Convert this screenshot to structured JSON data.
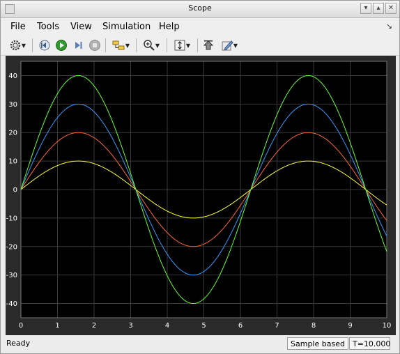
{
  "window": {
    "title": "Scope"
  },
  "menu": {
    "file": "File",
    "tools": "Tools",
    "view": "View",
    "simulation": "Simulation",
    "help": "Help"
  },
  "toolbar": {
    "icons": [
      "gear-icon",
      "step-back-icon",
      "run-icon",
      "step-forward-icon",
      "stop-icon",
      "signal-select-icon",
      "zoom-icon",
      "fit-axes-icon",
      "highlight-icon",
      "style-pen-icon"
    ]
  },
  "status": {
    "left": "Ready",
    "mode": "Sample based",
    "time": "T=10.000"
  },
  "colors": {
    "background": "#000000",
    "grid": "#3a3a3a",
    "axes_text": "#ffffff"
  },
  "chart_data": {
    "type": "line",
    "title": "",
    "xlabel": "",
    "ylabel": "",
    "xlim": [
      0,
      10
    ],
    "ylim": [
      -45,
      45
    ],
    "x_ticks": [
      "0",
      "1",
      "2",
      "3",
      "4",
      "5",
      "6",
      "7",
      "8",
      "9",
      "10"
    ],
    "y_ticks": [
      "40",
      "30",
      "20",
      "10",
      "0",
      "-10",
      "-20",
      "-30",
      "-40"
    ],
    "grid": true,
    "series": [
      {
        "color": "#ffff33",
        "function": "amplitude*sin(t)",
        "amplitude": 10
      },
      {
        "color": "#ff6633",
        "function": "amplitude*sin(t)",
        "amplitude": 20
      },
      {
        "color": "#3399ff",
        "function": "amplitude*sin(t)",
        "amplitude": 30
      },
      {
        "color": "#66ff33",
        "function": "amplitude*sin(t)",
        "amplitude": 40
      }
    ]
  }
}
